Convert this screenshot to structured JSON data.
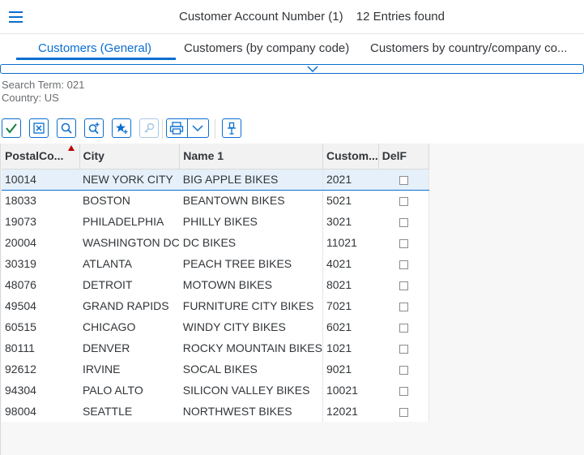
{
  "header": {
    "title": "Customer Account Number (1)",
    "entries": "12 Entries found"
  },
  "tabs": [
    {
      "label": "Customers (General)",
      "active": true
    },
    {
      "label": "Customers (by company code)",
      "active": false
    },
    {
      "label": "Customers by country/company co...",
      "active": false
    }
  ],
  "criteria": {
    "search_term": "Search Term: 021",
    "country": "Country: US"
  },
  "toolbar": {
    "buttons": [
      "check-icon",
      "cancel-icon",
      "search-icon",
      "zoom-in-icon",
      "favorite-icon",
      "link-icon",
      "print-icon",
      "dropdown-icon",
      "pin-icon"
    ]
  },
  "table": {
    "columns": [
      "PostalCo...",
      "City",
      "Name 1",
      "Custom...",
      "DelF"
    ],
    "rows": [
      {
        "postal": "10014",
        "city": "NEW YORK CITY",
        "name": "BIG APPLE BIKES",
        "customer": "2021",
        "del": false
      },
      {
        "postal": "18033",
        "city": "BOSTON",
        "name": "BEANTOWN BIKES",
        "customer": "5021",
        "del": false
      },
      {
        "postal": "19073",
        "city": "PHILADELPHIA",
        "name": "PHILLY BIKES",
        "customer": "3021",
        "del": false
      },
      {
        "postal": "20004",
        "city": "WASHINGTON DC",
        "name": "DC BIKES",
        "customer": "11021",
        "del": false
      },
      {
        "postal": "30319",
        "city": "ATLANTA",
        "name": "PEACH TREE BIKES",
        "customer": "4021",
        "del": false
      },
      {
        "postal": "48076",
        "city": "DETROIT",
        "name": "MOTOWN BIKES",
        "customer": "8021",
        "del": false
      },
      {
        "postal": "49504",
        "city": "GRAND RAPIDS",
        "name": "FURNITURE CITY BIKES",
        "customer": "7021",
        "del": false
      },
      {
        "postal": "60515",
        "city": "CHICAGO",
        "name": "WINDY CITY BIKES",
        "customer": "6021",
        "del": false
      },
      {
        "postal": "80111",
        "city": "DENVER",
        "name": "ROCKY MOUNTAIN BIKES",
        "customer": "1021",
        "del": false
      },
      {
        "postal": "92612",
        "city": "IRVINE",
        "name": "SOCAL BIKES",
        "customer": "9021",
        "del": false
      },
      {
        "postal": "94304",
        "city": "PALO ALTO",
        "name": "SILICON VALLEY BIKES",
        "customer": "10021",
        "del": false
      },
      {
        "postal": "98004",
        "city": "SEATTLE",
        "name": "NORTHWEST BIKES",
        "customer": "12021",
        "del": false
      }
    ]
  },
  "colors": {
    "accent": "#0a6ed1",
    "sort": "#bb0000",
    "selected": "#e5f0fa"
  }
}
